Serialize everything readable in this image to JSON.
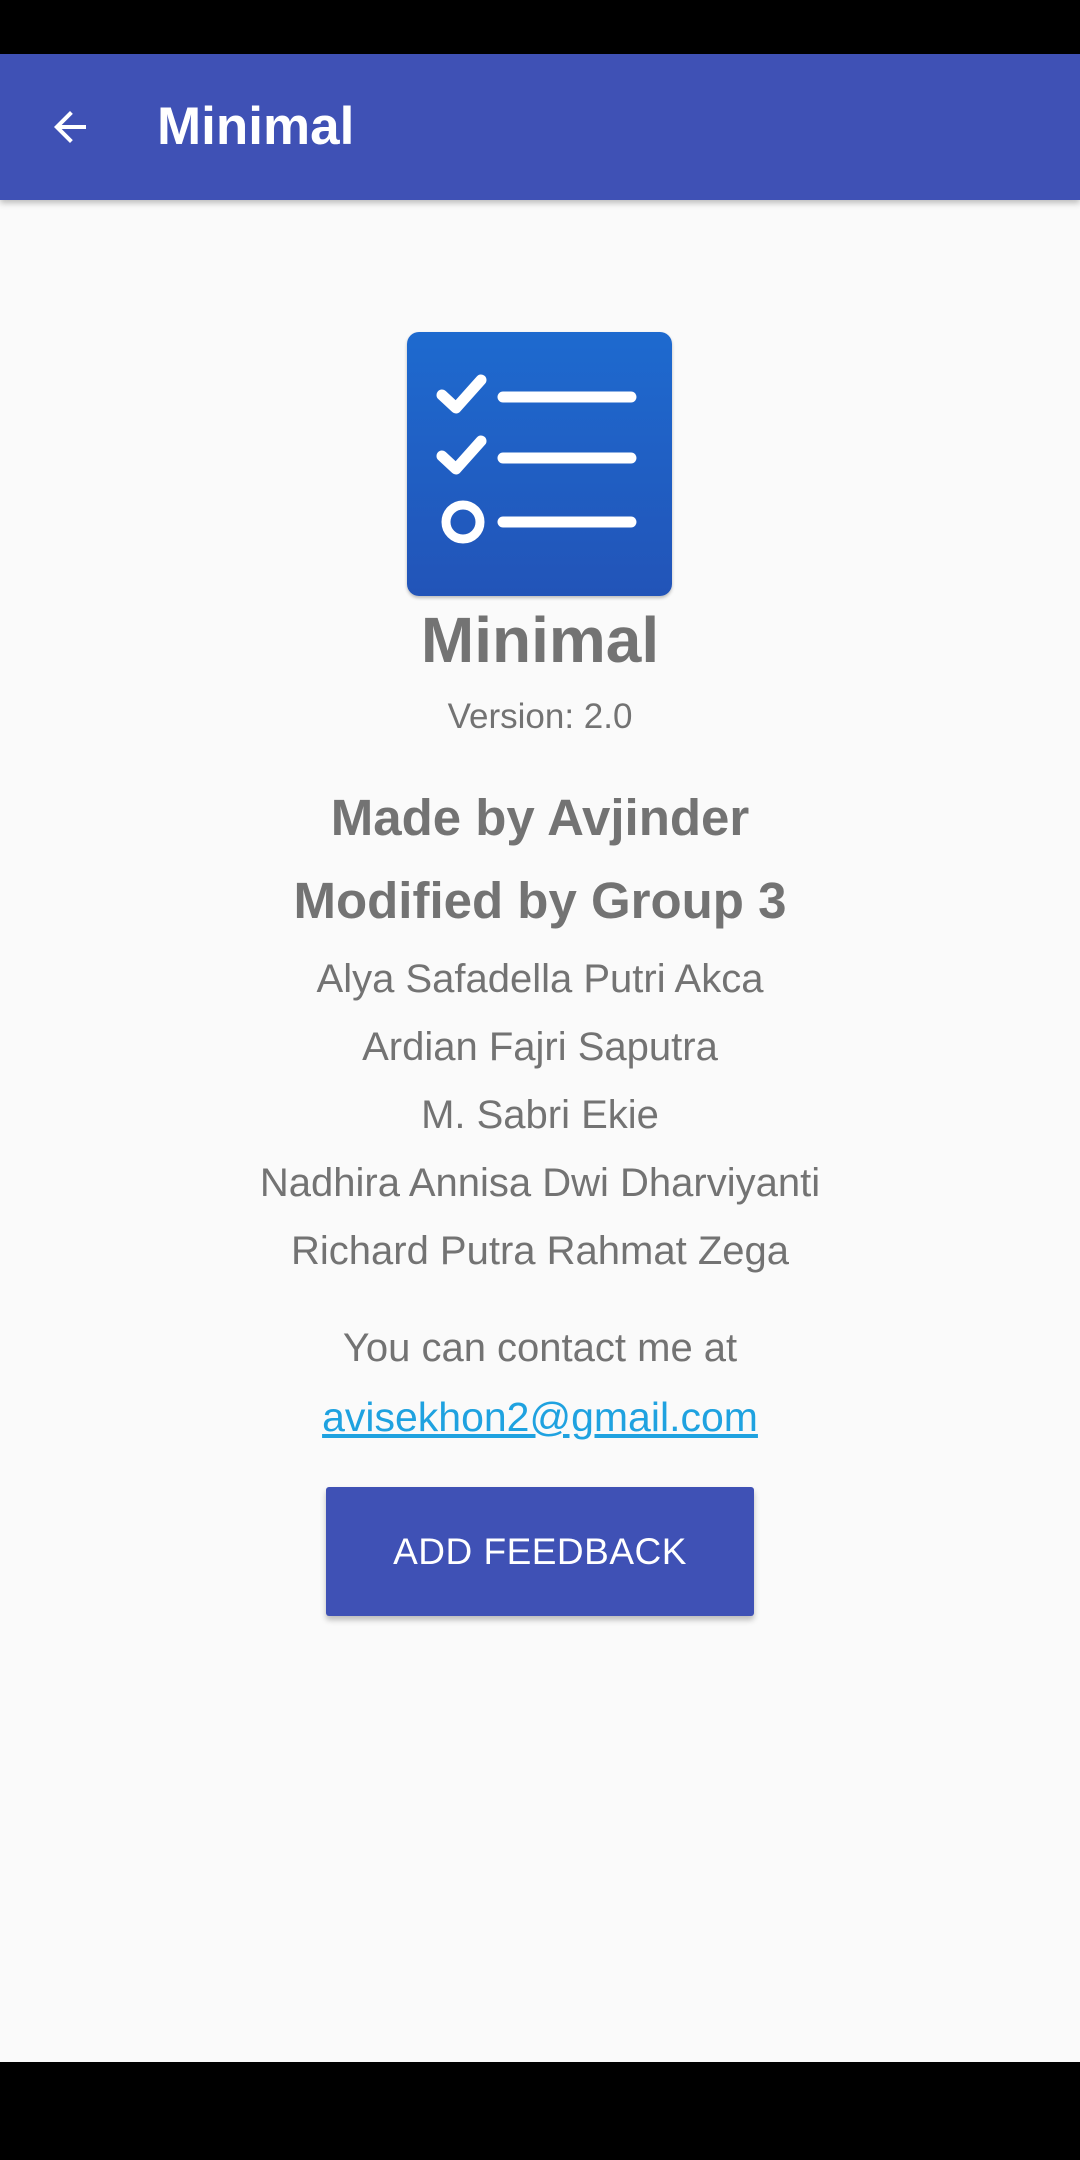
{
  "app_bar": {
    "title": "Minimal",
    "back_icon": "arrow-back-icon"
  },
  "about": {
    "app_icon": "checklist-icon",
    "app_name": "Minimal",
    "version": "Version: 2.0",
    "made_by": "Made by Avjinder",
    "modified_by": "Modified by Group 3",
    "members": [
      "Alya Safadella Putri Akca",
      "Ardian Fajri Saputra",
      "M. Sabri Ekie",
      "Nadhira Annisa Dwi Dharviyanti",
      "Richard Putra Rahmat Zega"
    ],
    "contact_text": "You can contact me at",
    "email": "avisekhon2@gmail.com",
    "feedback_button": "ADD FEEDBACK"
  },
  "colors": {
    "primary": "#3F51B5",
    "background": "#FAFAFA",
    "text": "#737373",
    "link": "#1FA2E0",
    "icon_background": "#2260C4"
  }
}
